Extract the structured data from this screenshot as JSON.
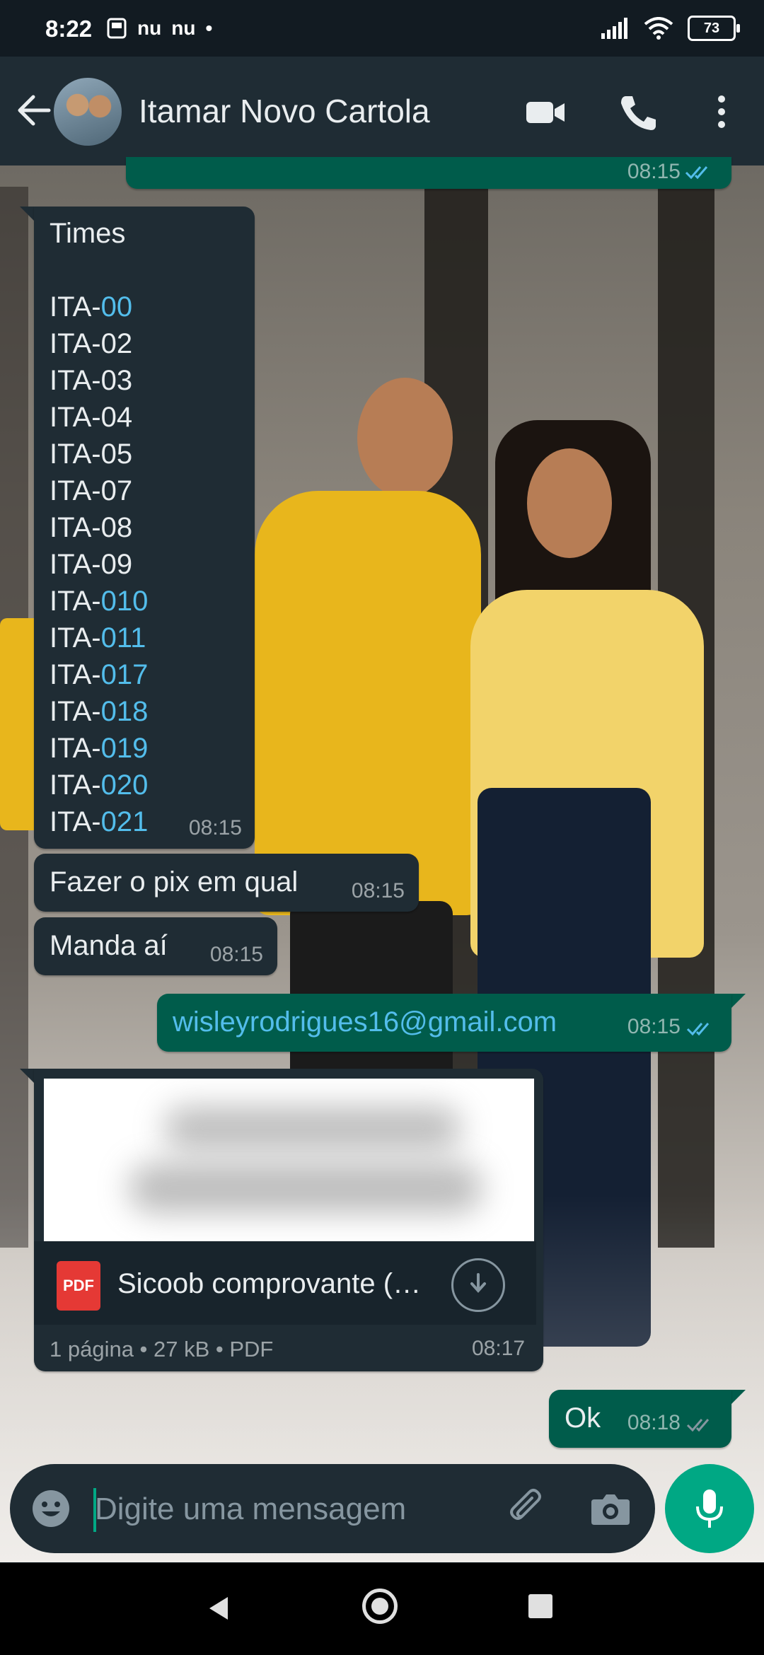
{
  "status_bar": {
    "time": "8:22",
    "left_icons": [
      "nu",
      "nu",
      "•"
    ],
    "battery": "73"
  },
  "header": {
    "title": "Itamar Novo Cartola"
  },
  "messages": {
    "partial_top": {
      "time": "08:15"
    },
    "teams": {
      "title": "Times",
      "items": [
        {
          "prefix": "ITA-",
          "num": "00",
          "link": true
        },
        {
          "prefix": "ITA-",
          "num": "02",
          "link": false
        },
        {
          "prefix": "ITA-",
          "num": "03",
          "link": false
        },
        {
          "prefix": "ITA-",
          "num": "04",
          "link": false
        },
        {
          "prefix": "ITA-",
          "num": "05",
          "link": false
        },
        {
          "prefix": "ITA-",
          "num": "07",
          "link": false
        },
        {
          "prefix": "ITA-",
          "num": "08",
          "link": false
        },
        {
          "prefix": "ITA-",
          "num": "09",
          "link": false
        },
        {
          "prefix": "ITA-",
          "num": "010",
          "link": true
        },
        {
          "prefix": "ITA-",
          "num": "011",
          "link": true
        },
        {
          "prefix": "ITA-",
          "num": "017",
          "link": true
        },
        {
          "prefix": "ITA-",
          "num": "018",
          "link": true
        },
        {
          "prefix": "ITA-",
          "num": "019",
          "link": true
        },
        {
          "prefix": "ITA-",
          "num": "020",
          "link": true
        },
        {
          "prefix": "ITA-",
          "num": "021",
          "link": true
        }
      ],
      "time": "08:15"
    },
    "pix": {
      "text": "Fazer o pix em qual",
      "time": "08:15"
    },
    "manda": {
      "text": "Manda aí",
      "time": "08:15"
    },
    "email": {
      "text": "wisleyrodrigues16@gmail.com",
      "time": "08:15"
    },
    "document": {
      "name": "Sicoob comprovante (…",
      "badge": "PDF",
      "meta": "1 página • 27 kB • PDF",
      "time": "08:17"
    },
    "ok": {
      "text": "Ok",
      "time": "08:18"
    }
  },
  "composer": {
    "placeholder": "Digite uma mensagem"
  },
  "colors": {
    "header": "#1f2c34",
    "incoming": "#1f2c34",
    "outgoing": "#005c4b",
    "accent": "#00a884",
    "link": "#53bdeb"
  }
}
